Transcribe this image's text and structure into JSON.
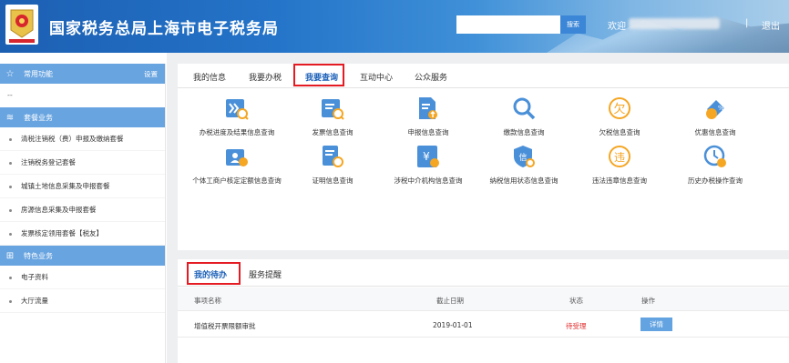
{
  "header": {
    "title": "国家税务总局上海市电子税务局",
    "search_placeholder": "",
    "search_button": "搜索",
    "welcome": "欢迎",
    "separator": "|",
    "logout": "退出"
  },
  "sidebar": {
    "common": {
      "label": "常用功能",
      "settings": "设置"
    },
    "dash": "--",
    "package": {
      "label": "套餐业务"
    },
    "package_items": [
      "清税注销税（费）申报及缴纳套餐",
      "注销税务登记套餐",
      "城镇土地信息采集及申报套餐",
      "房源信息采集及申报套餐",
      "发票核定领用套餐【税友】"
    ],
    "special": {
      "label": "特色业务"
    },
    "special_items": [
      "电子资料",
      "大厅流量"
    ]
  },
  "tabs": [
    "我的信息",
    "我要办税",
    "我要查询",
    "互动中心",
    "公众服务"
  ],
  "active_tab": "我要查询",
  "functions": [
    {
      "label": "办税进度及结果信息查询",
      "icon": "progress-query-icon"
    },
    {
      "label": "发票信息查询",
      "icon": "invoice-query-icon"
    },
    {
      "label": "申报信息查询",
      "icon": "declaration-query-icon"
    },
    {
      "label": "缴款信息查询",
      "icon": "payment-query-icon"
    },
    {
      "label": "欠税信息查询",
      "icon": "arrears-query-icon"
    },
    {
      "label": "优惠信息查询",
      "icon": "preferential-query-icon"
    },
    {
      "label": "个体工商户核定定额信息查询",
      "icon": "individual-business-icon"
    },
    {
      "label": "证明信息查询",
      "icon": "certificate-query-icon"
    },
    {
      "label": "涉税中介机构信息查询",
      "icon": "tax-agency-icon"
    },
    {
      "label": "纳税信用状态信息查询",
      "icon": "credit-status-icon"
    },
    {
      "label": "违法违章信息查询",
      "icon": "violation-query-icon"
    },
    {
      "label": "历史办税操作查询",
      "icon": "history-clock-icon"
    }
  ],
  "bottom_tabs": [
    "我的待办",
    "服务提醒"
  ],
  "table": {
    "headers": [
      "事项名称",
      "截止日期",
      "状态",
      "操作"
    ],
    "rows": [
      {
        "name": "增值税开票限额审批",
        "date": "2019-01-01",
        "status": "待受理",
        "action": "详情"
      }
    ]
  },
  "colors": {
    "header_blue": "#1c5fb2",
    "sidebar_head": "#68a4e0",
    "active_tab": "#1a5fb8",
    "highlight_box": "#e41b23",
    "pending_status": "#e02a2a",
    "icon_blue": "#4a90d9",
    "icon_orange": "#f5a623"
  }
}
